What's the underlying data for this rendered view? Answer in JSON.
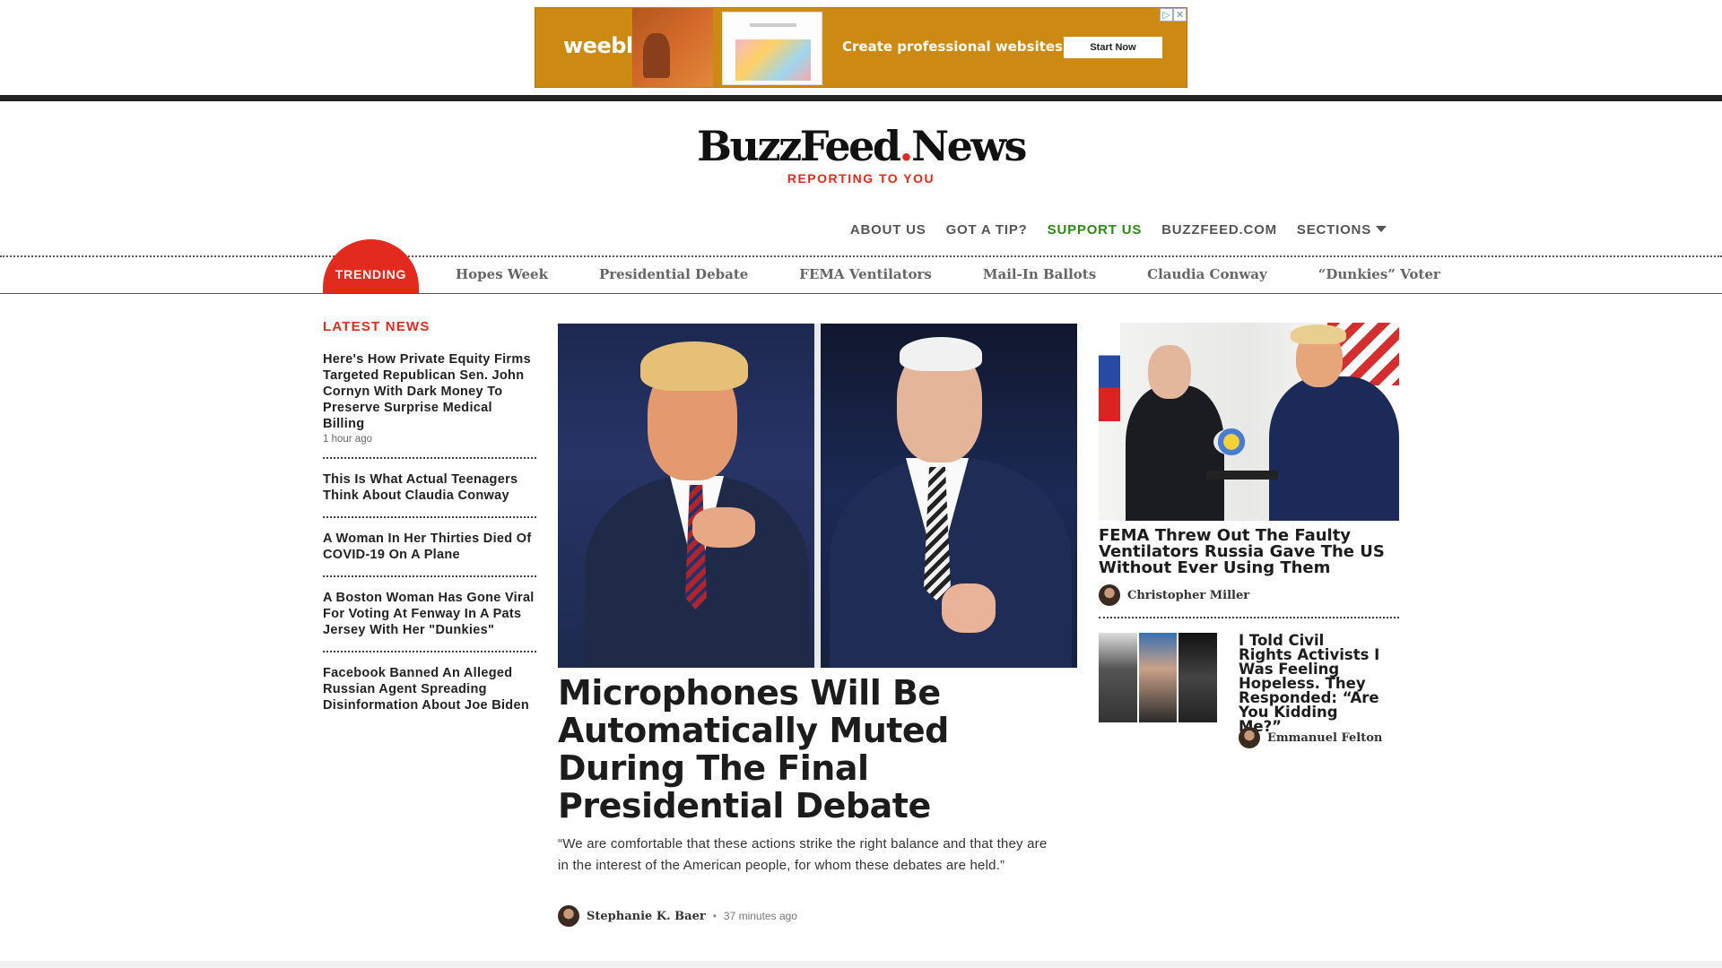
{
  "ad": {
    "brand": "weebly",
    "tagline": "Create professional websites",
    "cta": "Start Now",
    "adchoices": "▷",
    "close": "✕"
  },
  "header": {
    "logo_main": "BuzzFeed",
    "logo_dot": ".",
    "logo_end": "News",
    "tagline": "REPORTING TO YOU"
  },
  "topnav": {
    "about": "ABOUT US",
    "tip": "GOT A TIP?",
    "support": "SUPPORT US",
    "buzzfeed": "BUZZFEED.COM",
    "sections": "SECTIONS"
  },
  "trending": {
    "label": "TRENDING",
    "items": [
      "Hopes Week",
      "Presidential Debate",
      "FEMA Ventilators",
      "Mail-In Ballots",
      "Claudia Conway",
      "“Dunkies” Voter"
    ]
  },
  "latest": {
    "heading": "LATEST NEWS",
    "items": [
      {
        "title": "Here's How Private Equity Firms Targeted Republican Sen. John Cornyn With Dark Money To Preserve Surprise Medical Billing",
        "time": "1 hour ago"
      },
      {
        "title": "This Is What Actual Teenagers Think About Claudia Conway"
      },
      {
        "title": "A Woman In Her Thirties Died Of COVID-19 On A Plane"
      },
      {
        "title": "A Boston Woman Has Gone Viral For Voting At Fenway In A Pats Jersey With Her \"Dunkies\""
      },
      {
        "title": "Facebook Banned An Alleged Russian Agent Spreading Disinformation About Joe Biden"
      }
    ]
  },
  "main_story": {
    "title": "Microphones Will Be Automatically Muted During The Final Presidential Debate",
    "dek": "“We are comfortable that these actions strike the right balance and that they are in the interest of the American people, for whom these debates are held.”",
    "author": "Stephanie K. Baer",
    "separator": "•",
    "time": "37 minutes ago"
  },
  "side_story": {
    "title": "FEMA Threw Out The Faulty Ventilators Russia Gave The US Without Ever Using Them",
    "author": "Christopher Miller"
  },
  "side_story2": {
    "title": "I Told Civil Rights Activists I Was Feeling Hopeless. They Responded: “Are You Kidding Me?”",
    "author": "Emmanuel Felton"
  },
  "colors": {
    "accent": "#e32a1e",
    "support": "#2d8a16",
    "ad_bg": "#cc8a13"
  }
}
